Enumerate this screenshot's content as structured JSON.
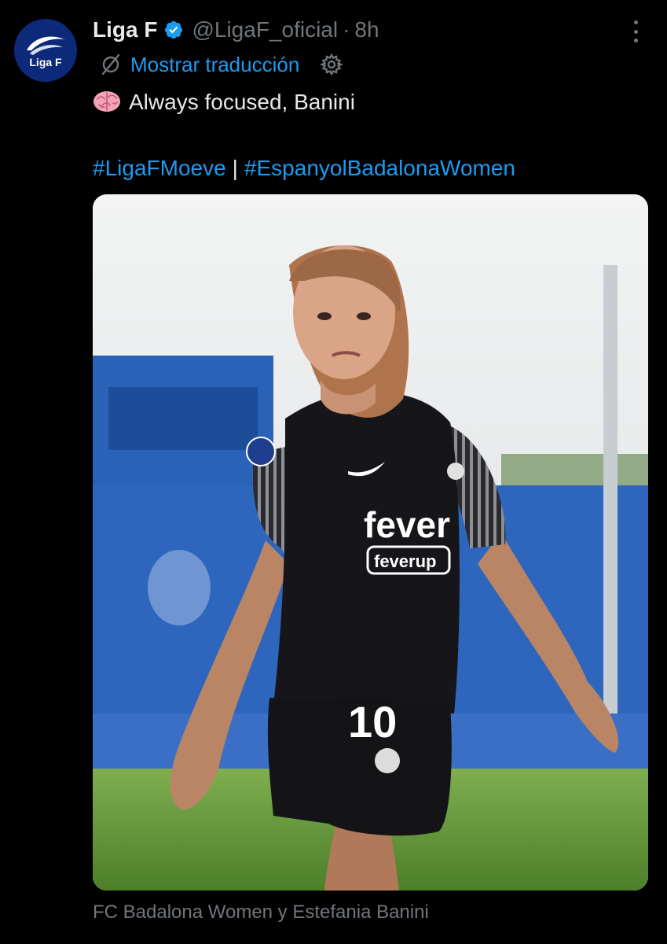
{
  "author": {
    "name": "Liga F",
    "handle": "@LigaF_oficial",
    "separator": "·",
    "time": "8h",
    "avatar_text": "Liga F",
    "verified": true
  },
  "translate": {
    "label": "Mostrar traducción",
    "icon": "translate-slash-icon",
    "settings_icon": "gear-icon"
  },
  "post": {
    "emoji": "brain-emoji",
    "text": "Always focused, Banini",
    "hashtags": [
      "#LigaFMoeve",
      "#EspanyolBadalonaWomen"
    ],
    "hashtag_separator": "|"
  },
  "media": {
    "sponsor_text": "fever",
    "sponsor_sub": "feverup",
    "shirt_number": "10",
    "tagged": "FC Badalona Women y Estefania Banini"
  },
  "colors": {
    "background": "#000000",
    "text": "#e7e9ea",
    "muted": "#71767b",
    "link": "#1d9bf0",
    "avatar_bg": "#0d2a7a"
  },
  "icons": {
    "more": "more-vertical-icon",
    "verified": "verified-badge-icon"
  }
}
